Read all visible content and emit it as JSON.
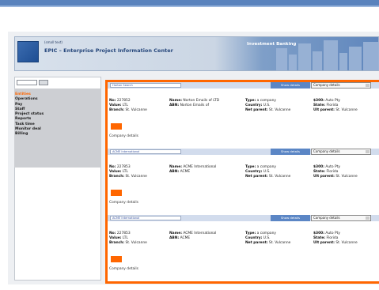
{
  "header": {
    "logo_sub": "(small text)",
    "app_title": "EPIC – Enterprise Project Information Center",
    "banner_right": "Investment Banking"
  },
  "sidebar": {
    "search_placeholder": "",
    "items": [
      {
        "label": "Entities",
        "active": true
      },
      {
        "label": "Operations"
      },
      {
        "label": "Pay"
      },
      {
        "label": "Staff"
      },
      {
        "label": "Project status"
      },
      {
        "label": "Reports"
      },
      {
        "label": "Task time"
      },
      {
        "label": "Monitor deal"
      },
      {
        "label": "Billing"
      }
    ]
  },
  "cards": [
    {
      "company_input": "Horton Search",
      "button": "Show details",
      "select": "Company details",
      "no_label": "No:",
      "no": "227852",
      "name_label": "Name:",
      "name": "Norton Emails of LTD",
      "type_label": "Type:",
      "type": "a company",
      "ebe_label": "$300:",
      "ebe": "Auto Pty",
      "value_label": "Value:",
      "value": "LTL",
      "abn_label": "ABN:",
      "abn": "Norton Emails of",
      "country_label": "Country:",
      "country": "U.S.",
      "state_label": "State:",
      "state": "Florida",
      "branch_label": "Branch:",
      "branch": "St. Vulcanne",
      "netparent_label": "Net parent:",
      "netparent": "St. Vulcanne",
      "ultparent_label": "Ult parent:",
      "ultparent": "St. Vulcanne",
      "details": "Company details"
    },
    {
      "company_input": "ACME International",
      "button": "Show details",
      "select": "Company details",
      "no_label": "No:",
      "no": "227853",
      "name_label": "Name:",
      "name": "ACME International",
      "type_label": "Type:",
      "type": "a company",
      "ebe_label": "$300:",
      "ebe": "Auto Pty",
      "value_label": "Value:",
      "value": "LTL",
      "abn_label": "ABN:",
      "abn": "ACME",
      "country_label": "Country:",
      "country": "U.S.",
      "state_label": "State:",
      "state": "Florida",
      "branch_label": "Branch:",
      "branch": "St. Vulcanne",
      "netparent_label": "Net parent:",
      "netparent": "St. Vulcanne",
      "ultparent_label": "Ult parent:",
      "ultparent": "St. Vulcanne",
      "details": "Company details"
    },
    {
      "company_input": "ACME International",
      "button": "Show details",
      "select": "Company details",
      "no_label": "No:",
      "no": "227853",
      "name_label": "Name:",
      "name": "ACME International",
      "type_label": "Type:",
      "type": "a company",
      "ebe_label": "$300:",
      "ebe": "Auto Pty",
      "value_label": "Value:",
      "value": "LTL",
      "abn_label": "ABN:",
      "abn": "ACME",
      "country_label": "Country:",
      "country": "U.S.",
      "state_label": "State:",
      "state": "Florida",
      "branch_label": "Branch:",
      "branch": "St. Vulcanne",
      "netparent_label": "Net parent:",
      "netparent": "St. Vulcanne",
      "ultparent_label": "Ult parent:",
      "ultparent": "St. Vulcanne",
      "details": "Company details"
    }
  ],
  "colors": {
    "accent": "#ff6600",
    "brand": "#5b86c5",
    "nav_bg": "#cdcfd3"
  }
}
